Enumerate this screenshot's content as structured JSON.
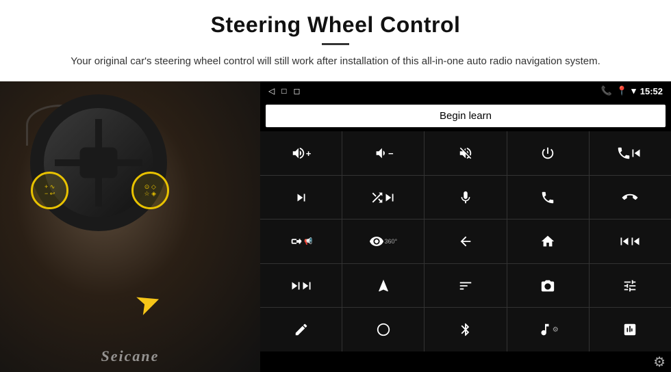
{
  "header": {
    "title": "Steering Wheel Control",
    "subtitle": "Your original car's steering wheel control will still work after installation of this all-in-one auto radio navigation system."
  },
  "status_bar": {
    "time": "15:52",
    "nav_back": "◁",
    "nav_home": "□",
    "nav_recent": "◻"
  },
  "begin_learn": {
    "label": "Begin learn"
  },
  "controls": [
    {
      "icon": "vol_up",
      "symbol": "🔊+"
    },
    {
      "icon": "vol_down",
      "symbol": "🔊-"
    },
    {
      "icon": "mute",
      "symbol": "🔇"
    },
    {
      "icon": "power",
      "symbol": "⏻"
    },
    {
      "icon": "prev_track",
      "symbol": "⏮"
    },
    {
      "icon": "next",
      "symbol": "⏭"
    },
    {
      "icon": "shuffle",
      "symbol": "⇄⏩"
    },
    {
      "icon": "mic",
      "symbol": "🎤"
    },
    {
      "icon": "phone",
      "symbol": "📞"
    },
    {
      "icon": "hang_up",
      "symbol": "📵"
    },
    {
      "icon": "horn",
      "symbol": "📢"
    },
    {
      "icon": "view360",
      "symbol": "👁360"
    },
    {
      "icon": "back",
      "symbol": "↩"
    },
    {
      "icon": "home",
      "symbol": "⌂"
    },
    {
      "icon": "skip_back",
      "symbol": "⏮⏮"
    },
    {
      "icon": "fast_fwd",
      "symbol": "⏭⏭"
    },
    {
      "icon": "nav",
      "symbol": "◀"
    },
    {
      "icon": "eq",
      "symbol": "⇌"
    },
    {
      "icon": "camera",
      "symbol": "📷"
    },
    {
      "icon": "settings2",
      "symbol": "🎚"
    },
    {
      "icon": "pen",
      "symbol": "✏"
    },
    {
      "icon": "circle",
      "symbol": "⊙"
    },
    {
      "icon": "bluetooth",
      "symbol": "⚡"
    },
    {
      "icon": "music",
      "symbol": "♫"
    },
    {
      "icon": "equalizer",
      "symbol": "|||"
    }
  ],
  "bottom": {
    "gear_label": "⚙"
  },
  "seicane": {
    "watermark": "Seicane"
  }
}
